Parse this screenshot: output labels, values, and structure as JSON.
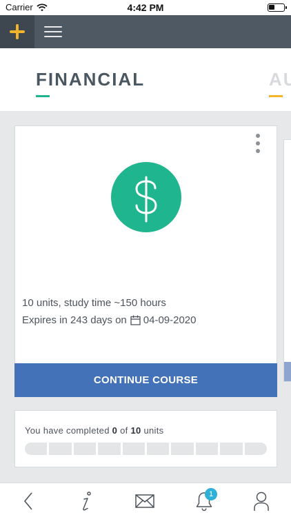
{
  "status_bar": {
    "carrier": "Carrier",
    "time": "4:42 PM",
    "icons": [
      "wifi-icon",
      "battery-icon"
    ]
  },
  "app_bar": {
    "add_icon": "plus-icon",
    "menu_icon": "hamburger-menu-icon",
    "accent_color": "#f2b52a"
  },
  "tabs": [
    {
      "label": "FINANCIAL",
      "accent": "#1fb58f",
      "selected": true
    },
    {
      "label": "AU",
      "accent": "#f2b52a",
      "selected": false
    }
  ],
  "course": {
    "icon": "dollar-icon",
    "icon_color": "#1fb58f",
    "units_text": "10 units, study time ~150 hours",
    "expires_prefix": "Expires in 243 days on",
    "expires_date": "04-09-2020",
    "continue_label": "CONTINUE COURSE",
    "button_color": "#4472b9"
  },
  "progress": {
    "prefix": "You have completed",
    "completed": "0",
    "middle": "of",
    "total": "10",
    "suffix": "units",
    "fraction": 0
  },
  "bottom_nav": {
    "items": [
      "back-icon",
      "info-icon",
      "mail-icon",
      "bell-icon",
      "profile-icon"
    ],
    "notification_count": "1"
  }
}
